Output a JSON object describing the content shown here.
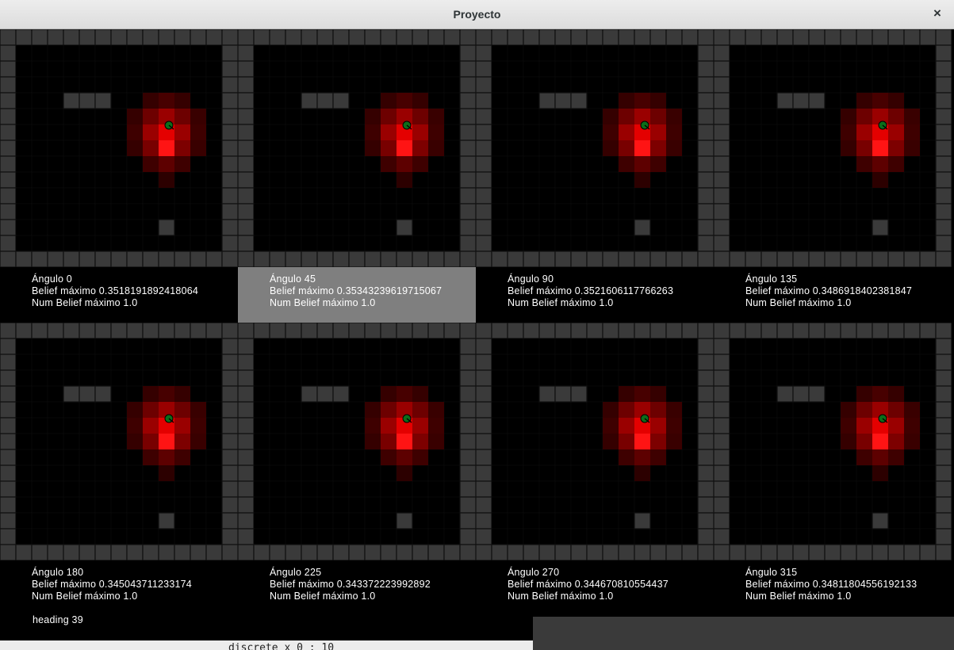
{
  "window": {
    "title": "Proyecto",
    "close_glyph": "×"
  },
  "colors": {
    "wall": "#3a3a3a",
    "grid_line": "#101010",
    "floor": "#000000",
    "robot": "#0c6e1a",
    "selected_panel": "#7f7f7f"
  },
  "panels": [
    {
      "angle": "Ángulo 0",
      "belief": "Belief máximo 0.3518191892418064",
      "num": "Num Belief máximo 1.0",
      "selected": false
    },
    {
      "angle": "Ángulo 45",
      "belief": "Belief máximo 0.35343239619715067",
      "num": "Num Belief máximo 1.0",
      "selected": true
    },
    {
      "angle": "Ángulo 90",
      "belief": "Belief máximo 0.3521606117766263",
      "num": "Num Belief máximo 1.0",
      "selected": false
    },
    {
      "angle": "Ángulo 135",
      "belief": "Belief máximo 0.3486918402381847",
      "num": "Num Belief máximo 1.0",
      "selected": false
    },
    {
      "angle": "Ángulo 180",
      "belief": "Belief máximo 0.345043711233174",
      "num": "Num Belief máximo 1.0",
      "selected": false
    },
    {
      "angle": "Ángulo 225",
      "belief": "Belief máximo 0.343372223992892",
      "num": "Num Belief máximo 1.0",
      "selected": false
    },
    {
      "angle": "Ángulo 270",
      "belief": "Belief máximo 0.344670810554437",
      "num": "Num Belief máximo 1.0",
      "selected": false
    },
    {
      "angle": "Ángulo 315",
      "belief": "Belief máximo 0.34811804556192133",
      "num": "Num Belief máximo 1.0",
      "selected": false
    }
  ],
  "heading": "heading 39",
  "background_code_fragment": "discrete x 0 : 10"
}
